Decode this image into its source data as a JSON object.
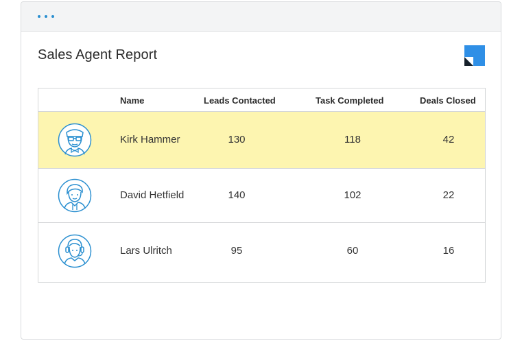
{
  "window": {
    "menu_icon": "ellipsis-icon"
  },
  "report": {
    "title": "Sales Agent Report",
    "brand_icon": "brand-logo-icon"
  },
  "table": {
    "headers": [
      "",
      "Name",
      "Leads Contacted",
      "Task Completed",
      "Deals Closed"
    ],
    "rows": [
      {
        "avatar": "agent-avatar-glasses-icon",
        "name": "Kirk Hammer",
        "leads": "130",
        "tasks": "118",
        "deals": "42",
        "highlighted": true
      },
      {
        "avatar": "agent-avatar-hoodie-icon",
        "name": "David Hetfield",
        "leads": "140",
        "tasks": "102",
        "deals": "22",
        "highlighted": false
      },
      {
        "avatar": "agent-avatar-headset-icon",
        "name": "Lars Ulritch",
        "leads": "95",
        "tasks": "60",
        "deals": "16",
        "highlighted": false
      }
    ]
  },
  "colors": {
    "accent": "#2a8fd0",
    "highlight_row": "#fdf5b0",
    "brand_blue": "#2f8fe6"
  }
}
